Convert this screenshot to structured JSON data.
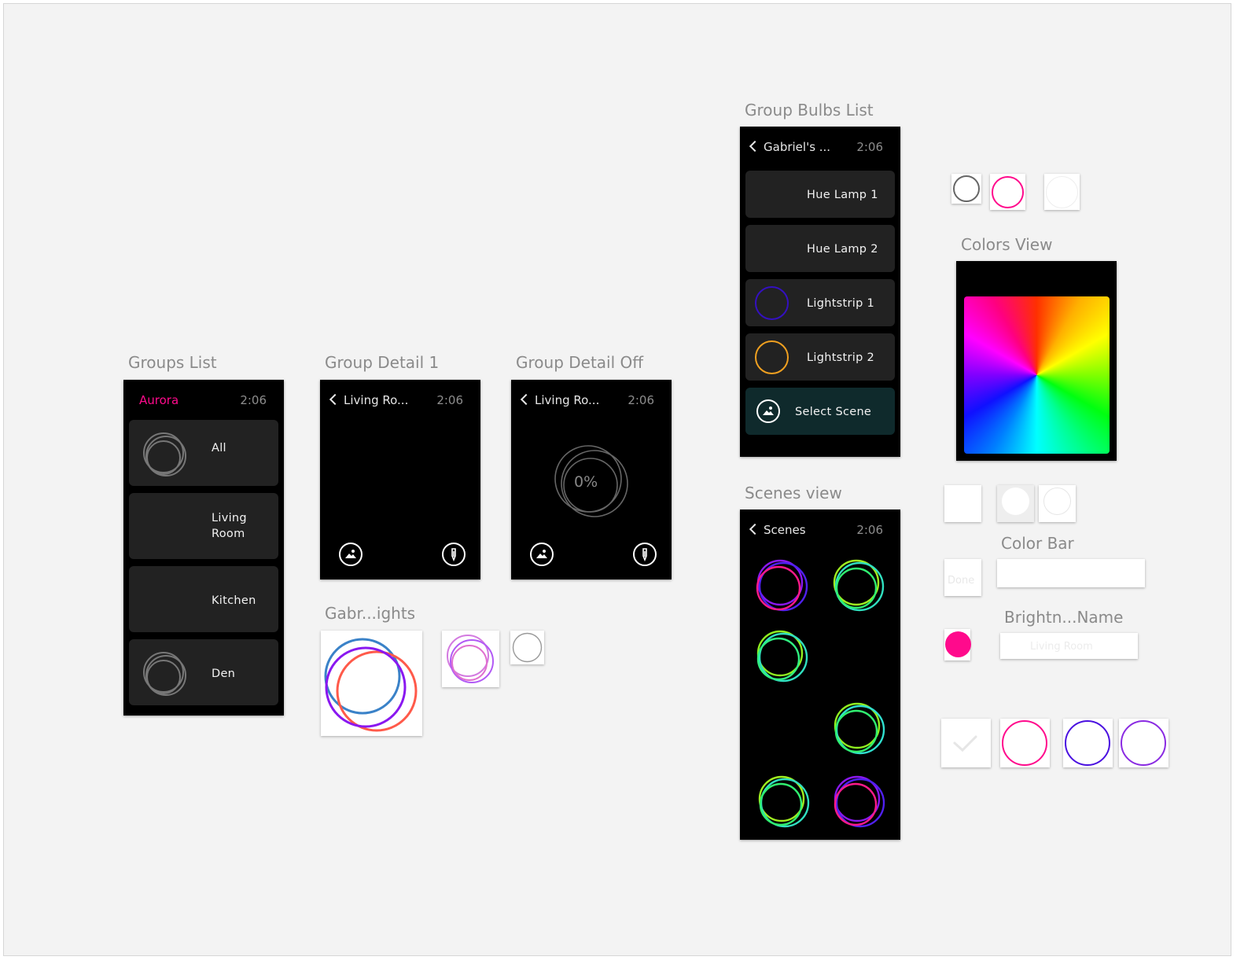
{
  "labels": {
    "groups_list": "Groups List",
    "group_detail_1": "Group Detail 1",
    "group_detail_off": "Group Detail Off",
    "gabr_lights": "Gabr...ights",
    "group_bulbs_list": "Group Bulbs List",
    "colors_view": "Colors View",
    "scenes_view": "Scenes view",
    "color_bar": "Color Bar",
    "brightness_name": "Brightn...Name"
  },
  "groups_list": {
    "app_title": "Aurora",
    "time": "2:06",
    "items": [
      {
        "label": "All"
      },
      {
        "label": "Living\nRoom"
      },
      {
        "label": "Kitchen"
      },
      {
        "label": "Den"
      }
    ]
  },
  "group_detail_1": {
    "title": "Living Ro...",
    "time": "2:06"
  },
  "group_detail_off": {
    "title": "Living Ro...",
    "time": "2:06",
    "brightness": "0%"
  },
  "group_bulbs_list": {
    "title": "Gabriel's ...",
    "time": "2:06",
    "bulbs": [
      {
        "label": "Hue Lamp 1"
      },
      {
        "label": "Hue Lamp 2"
      },
      {
        "label": "Lightstrip 1"
      },
      {
        "label": "Lightstrip 2"
      }
    ],
    "select_scene": "Select Scene"
  },
  "scenes_view": {
    "title": "Scenes",
    "time": "2:06"
  },
  "controls": {
    "done_label": "Done",
    "name_placeholder": "Living Room"
  },
  "colors": {
    "accent_pink": "#ff0a8c",
    "select_scene_bg": "#0f2a2c",
    "purple": "#6a28ff",
    "violet": "#8a2be2",
    "orange": "#f0a020"
  },
  "icons": [
    "scene-image-icon",
    "color-dropper-icon",
    "chevron-left-icon",
    "checkmark-icon"
  ]
}
